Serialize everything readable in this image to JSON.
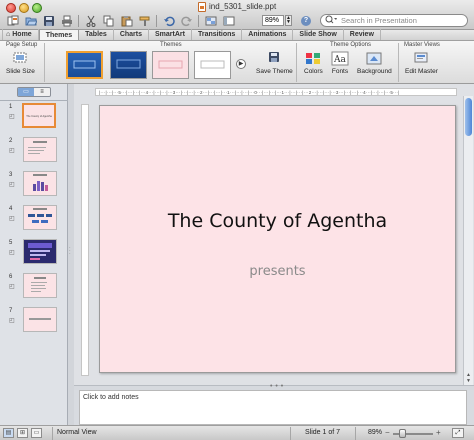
{
  "window": {
    "title": "ind_5301_slide.ppt"
  },
  "toolbar": {
    "icons": [
      "new-icon",
      "open-icon",
      "save-icon",
      "print-icon",
      "cut-icon",
      "copy-icon",
      "paste-icon",
      "format-icon",
      "undo-icon",
      "redo-icon",
      "gallery-icon",
      "sidebar-icon"
    ],
    "zoom": "89%",
    "help": "?",
    "search_placeholder": "Search in Presentation"
  },
  "tabs": [
    {
      "label": "Home"
    },
    {
      "label": "Themes"
    },
    {
      "label": "Tables"
    },
    {
      "label": "Charts"
    },
    {
      "label": "SmartArt"
    },
    {
      "label": "Transitions"
    },
    {
      "label": "Animations"
    },
    {
      "label": "Slide Show"
    },
    {
      "label": "Review"
    }
  ],
  "active_tab": "Themes",
  "ribbon": {
    "groups": {
      "page_setup": "Page Setup",
      "themes": "Themes",
      "theme_options": "Theme Options",
      "master_views": "Master Views"
    },
    "buttons": {
      "slide_size": "Slide Size",
      "save_theme": "Save Theme",
      "colors": "Colors",
      "fonts": "Fonts",
      "background": "Background",
      "edit_master": "Edit Master"
    }
  },
  "slides_panel": {
    "numbers": [
      "1",
      "2",
      "3",
      "4",
      "5",
      "6",
      "7"
    ],
    "thumb_titles": [
      "The County of Agentha",
      "",
      "",
      "",
      "",
      "",
      ""
    ],
    "selected": "1"
  },
  "slide": {
    "title": "The County of Agentha",
    "subtitle": "presents"
  },
  "notes": {
    "placeholder": "Click to add notes"
  },
  "statusbar": {
    "view_mode": "Normal View",
    "slide_position": "Slide 1 of 7",
    "zoom": "89%"
  },
  "colors": {
    "slide_background": "#fde3e7",
    "selection_accent": "#e78a36",
    "scroll_thumb": "#4e86d6"
  }
}
